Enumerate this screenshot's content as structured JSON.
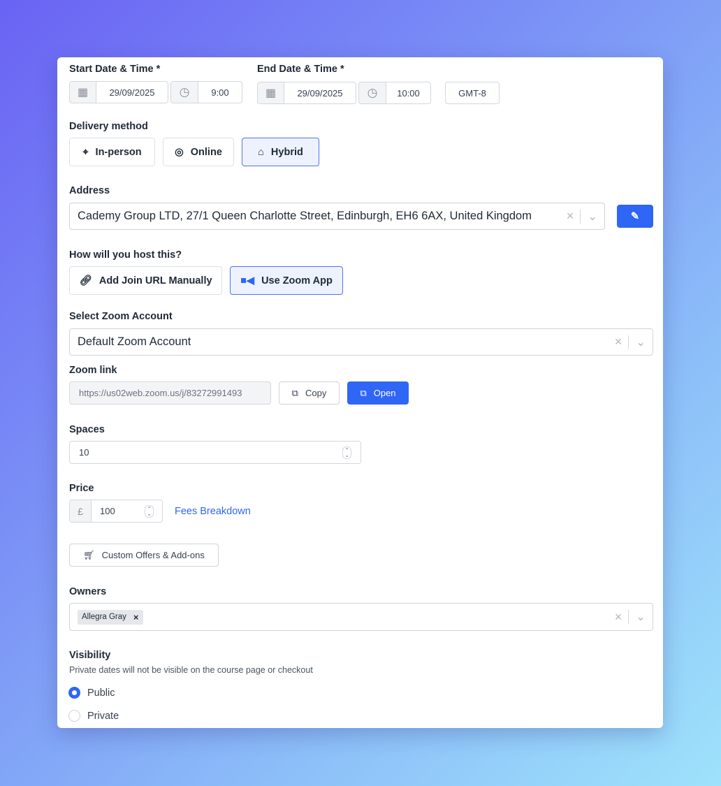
{
  "start": {
    "label": "Start Date & Time *",
    "date": "29/09/2025",
    "time": "9:00"
  },
  "end": {
    "label": "End Date & Time *",
    "date": "29/09/2025",
    "time": "10:00"
  },
  "timezone": "GMT-8",
  "delivery": {
    "label": "Delivery method",
    "options": [
      "In-person",
      "Online",
      "Hybrid"
    ],
    "selected": "Hybrid"
  },
  "address": {
    "label": "Address",
    "value": "Cademy Group LTD, 27/1 Queen Charlotte Street, Edinburgh, EH6 6AX, United Kingdom"
  },
  "hosting": {
    "label": "How will you host this?",
    "options": [
      "Add Join URL Manually",
      "Use Zoom App"
    ],
    "selected": "Use Zoom App"
  },
  "zoom_account": {
    "label": "Select Zoom Account",
    "value": "Default Zoom Account"
  },
  "zoom_link": {
    "label": "Zoom link",
    "value": "https://us02web.zoom.us/j/83272991493",
    "copy": "Copy",
    "open": "Open"
  },
  "spaces": {
    "label": "Spaces",
    "value": "10"
  },
  "price": {
    "label": "Price",
    "currency": "£",
    "value": "100",
    "fees_link": "Fees Breakdown"
  },
  "custom_offers": "Custom Offers & Add-ons",
  "owners": {
    "label": "Owners",
    "tags": [
      "Allegra Gray"
    ]
  },
  "visibility": {
    "label": "Visibility",
    "help": "Private dates will not be visible on the course page or checkout",
    "options": [
      "Public",
      "Private"
    ],
    "selected": "Public"
  },
  "colors": {
    "accent": "#2f66f5",
    "selected_bg": "#eef2ff"
  }
}
